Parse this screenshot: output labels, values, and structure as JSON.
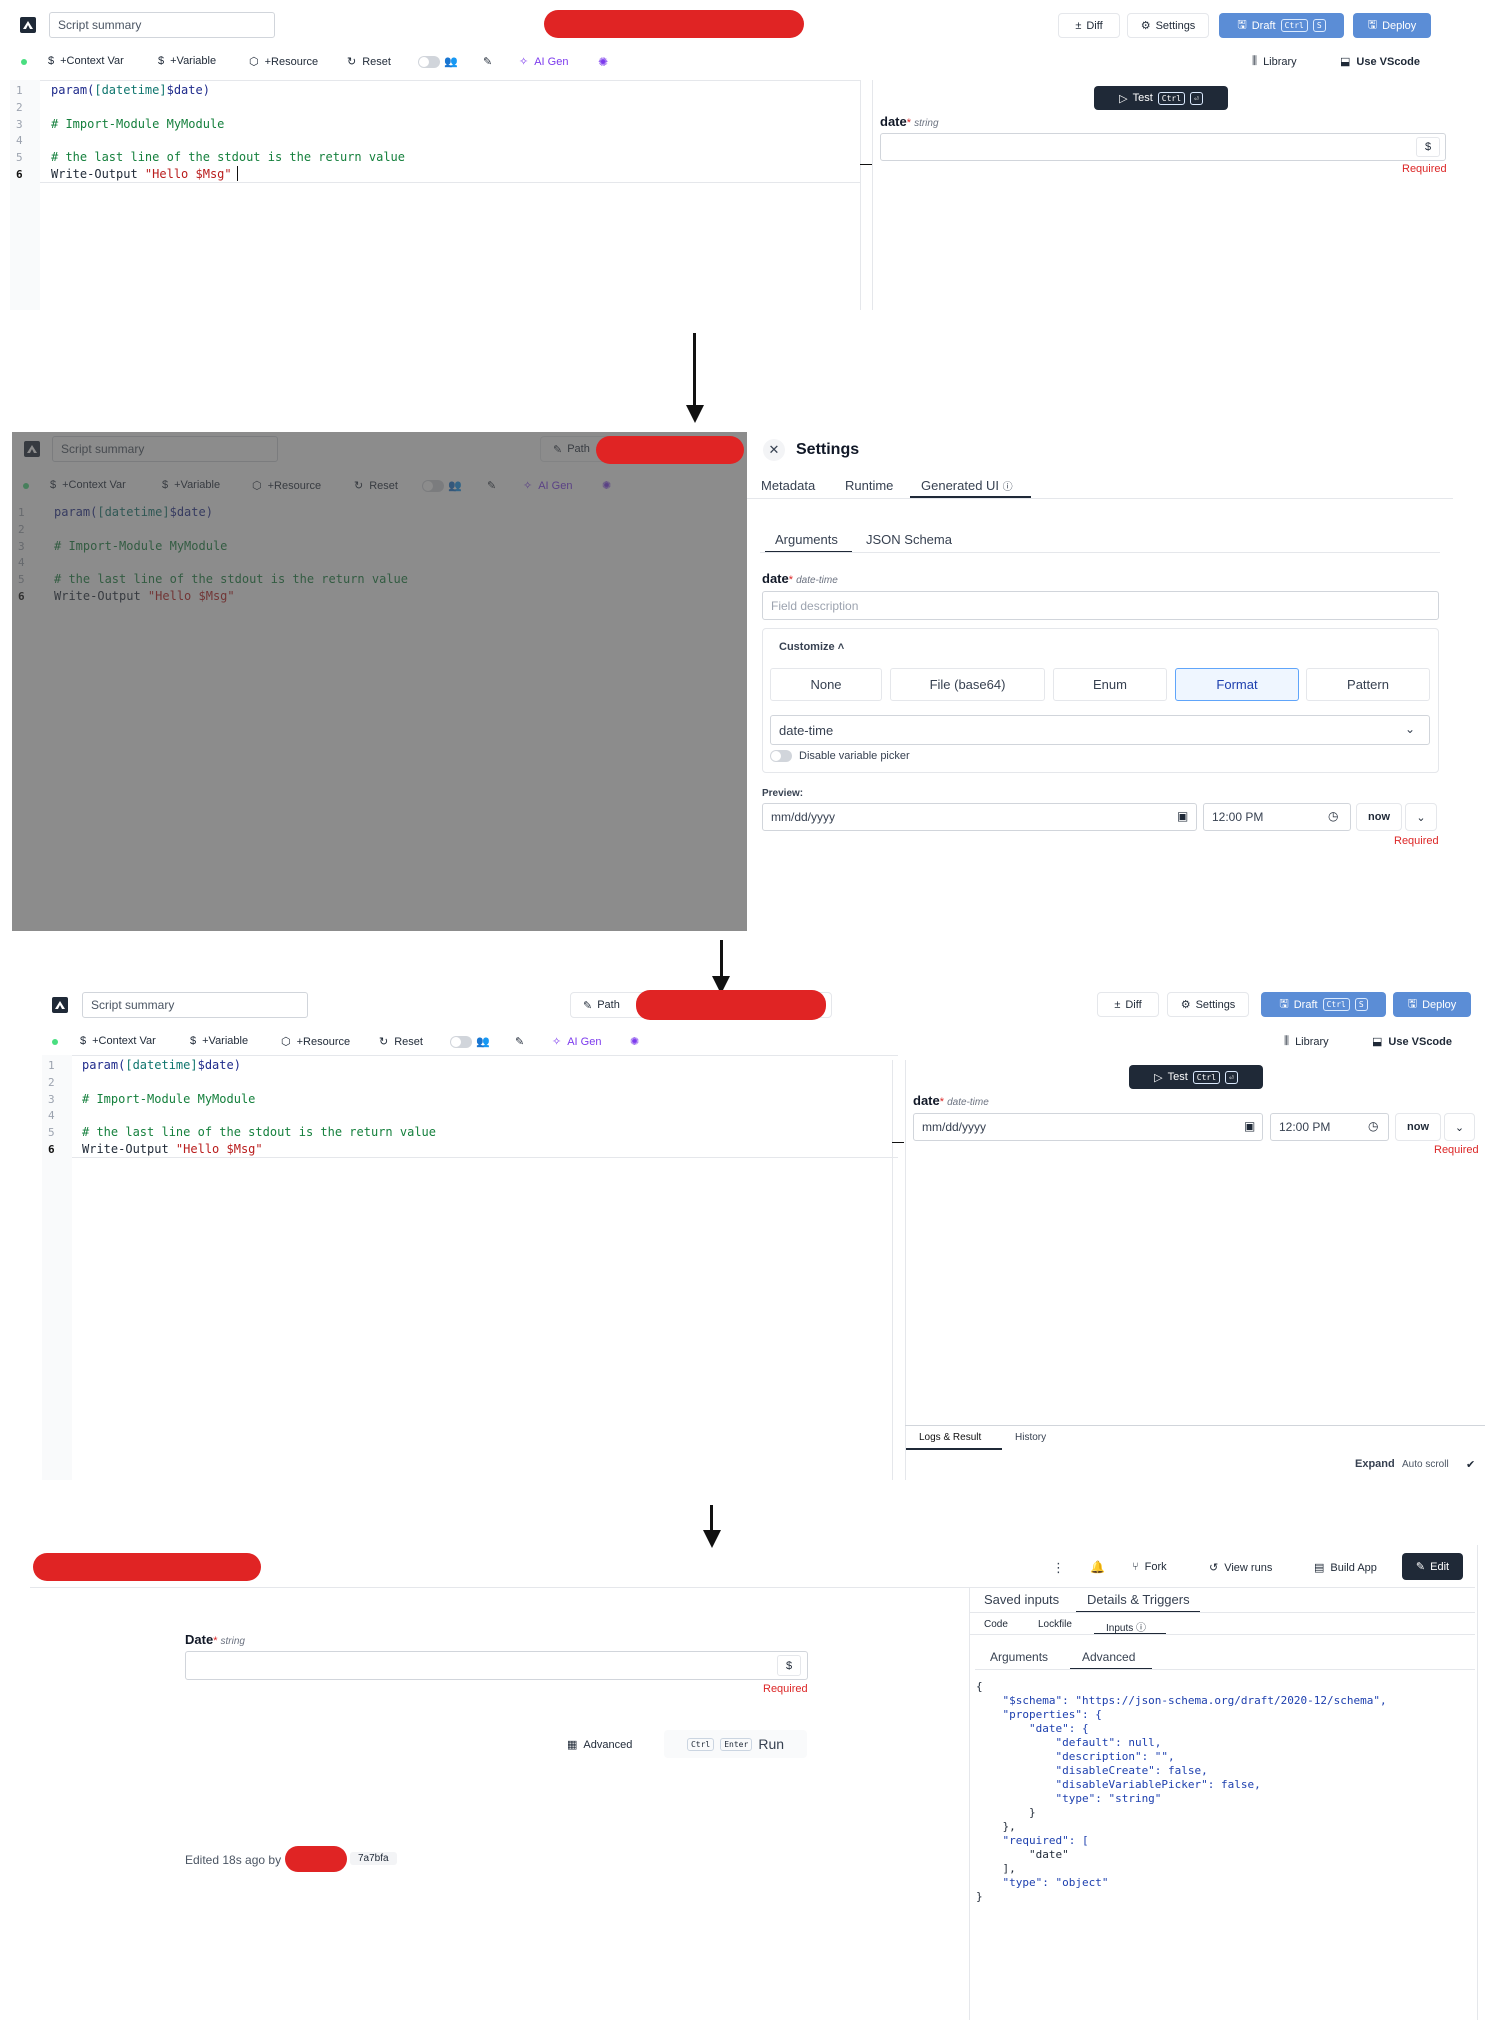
{
  "editor": {
    "summary_placeholder": "Script summary",
    "toolbar": {
      "diff": "Diff",
      "settings": "Settings",
      "draft": "Draft",
      "draft_kbd1": "Ctrl",
      "draft_kbd2": "S",
      "deploy": "Deploy",
      "path": "Path",
      "context_var": "+Context Var",
      "variable": "+Variable",
      "resource": "+Resource",
      "reset": "Reset",
      "ai_gen": "AI Gen",
      "library": "Library",
      "use_vscode": "Use VScode"
    },
    "line_numbers": [
      "1",
      "2",
      "3",
      "4",
      "5",
      "6"
    ],
    "code": {
      "l1_kw": "param(",
      "l1_type": "[datetime]",
      "l1_var": "$date)",
      "l3": "# Import-Module MyModule",
      "l5": "# the last line of the stdout is the return value",
      "l6_cmd": "Write-Output ",
      "l6_str": "\"Hello $Msg\""
    },
    "test_button": "Test",
    "test_kbd": "Ctrl",
    "test_kbd2": "⏎"
  },
  "panel1": {
    "field_label": "date",
    "field_type": "string",
    "currency_symbol": "$",
    "required": "Required"
  },
  "settings": {
    "title": "Settings",
    "tabs": [
      "Metadata",
      "Runtime",
      "Generated UI"
    ],
    "subtabs": [
      "Arguments",
      "JSON Schema"
    ],
    "field_label": "date",
    "field_type": "date-time",
    "description_placeholder": "Field description",
    "customize": "Customize",
    "options": [
      "None",
      "File (base64)",
      "Enum",
      "Format",
      "Pattern"
    ],
    "format_value": "date-time",
    "disable_picker": "Disable variable picker",
    "preview": "Preview:",
    "date_placeholder": "mm/dd/yyyy",
    "time_value": "12:00 PM",
    "now": "now",
    "required": "Required"
  },
  "panel3": {
    "field_label": "date",
    "field_type": "date-time",
    "date_placeholder": "mm/dd/yyyy",
    "time_value": "12:00 PM",
    "now": "now",
    "required": "Required",
    "logs_tab": "Logs & Result",
    "history_tab": "History",
    "expand": "Expand",
    "auto_scroll": "Auto scroll"
  },
  "run_view": {
    "header_buttons": [
      "Fork",
      "View runs",
      "Build App",
      "Edit"
    ],
    "field_label": "Date",
    "field_type": "string",
    "currency_symbol": "$",
    "required": "Required",
    "advanced": "Advanced",
    "run_kbd1": "Ctrl",
    "run_kbd2": "Enter",
    "run": "Run",
    "edited": "Edited 18s ago by",
    "commit": "7a7bfa",
    "top_tabs": [
      "Saved inputs",
      "Details & Triggers"
    ],
    "sub_tabs": [
      "Code",
      "Lockfile",
      "Inputs"
    ],
    "inner_tabs": [
      "Arguments",
      "Advanced"
    ],
    "json_lines": [
      "{",
      "    \"$schema\": \"https://json-schema.org/draft/2020-12/schema\",",
      "    \"properties\": {",
      "        \"date\": {",
      "            \"default\": null,",
      "            \"description\": \"\",",
      "            \"disableCreate\": false,",
      "            \"disableVariablePicker\": false,",
      "            \"type\": \"string\"",
      "        }",
      "    },",
      "    \"required\": [",
      "        \"date\"",
      "    ],",
      "    \"type\": \"object\"",
      "}"
    ]
  },
  "colors": {
    "accent_blue": "#5b8dd6",
    "dark": "#1f2937",
    "required_red": "#dc2626",
    "redaction": "#e02424",
    "ai_purple": "#7c3aed"
  }
}
